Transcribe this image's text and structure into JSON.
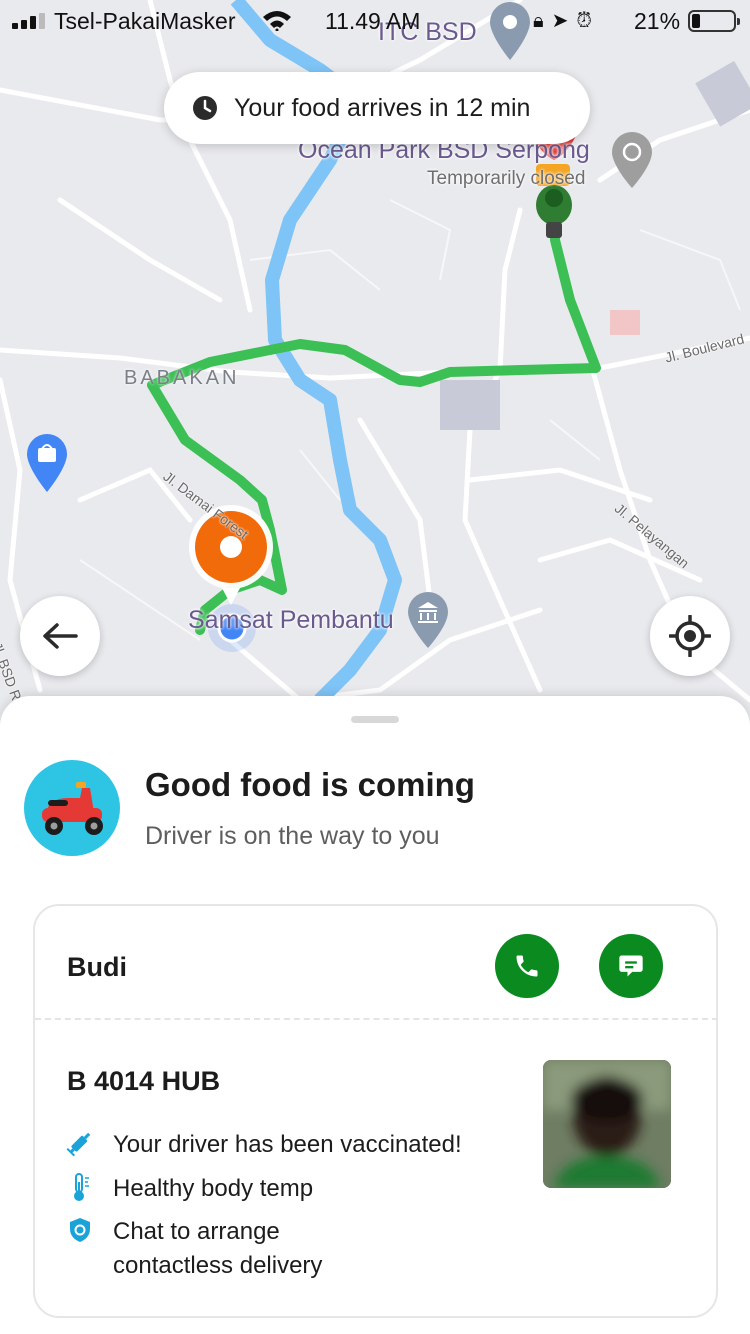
{
  "status_bar": {
    "carrier": "Tsel-PakaiMasker",
    "time": "11.49 AM",
    "battery_percent": "21%",
    "battery_level": 0.21
  },
  "map": {
    "eta_text": "Your food arrives in 12 min",
    "places": {
      "itc_bsd": "ITC BSD",
      "ocean_park": "Ocean Park BSD Serpong",
      "ocean_park_status": "Temporarily closed",
      "babakan": "BABAKAN",
      "destination": "Samsat Pembantu"
    },
    "roads": {
      "boulevard": "Jl. Boulevard",
      "damai_forest": "Jl. Damai Forest",
      "pelayangan": "Jl. Pelayangan",
      "bsd_raya": "Jl. BSD Ra"
    },
    "colors": {
      "route": "#3cc056",
      "water": "#7fc4f7",
      "pin": "#f26b0a",
      "user_dot": "#4285f4"
    }
  },
  "sheet": {
    "status_title": "Good food is coming",
    "status_subtitle": "Driver is on the way to you",
    "driver": {
      "name": "Budi",
      "plate": "B 4014 HUB"
    },
    "features": [
      {
        "icon": "syringe-icon",
        "text": "Your driver has been vaccinated!"
      },
      {
        "icon": "thermometer-icon",
        "text": "Healthy body temp"
      },
      {
        "icon": "shield-icon",
        "text": "Chat to arrange\ncontactless delivery"
      }
    ],
    "accent": "#0a8a1f",
    "info_icon_color": "#1aa3d9"
  }
}
